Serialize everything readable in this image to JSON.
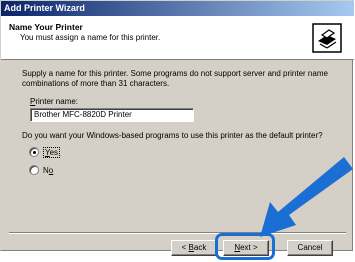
{
  "window": {
    "title": "Add Printer Wizard"
  },
  "header": {
    "title": "Name Your Printer",
    "subtitle": "You must assign a name for this printer."
  },
  "body": {
    "description": "Supply a name for this printer. Some programs do not support server and printer name combinations of more than 31 characters.",
    "printer_name_label": "Printer name:",
    "printer_name_value": "Brother MFC-8820D Printer",
    "default_question": "Do you want your Windows-based programs to use this printer as the default printer?",
    "options": [
      {
        "label": "Yes",
        "selected": true
      },
      {
        "label": "No",
        "selected": false
      }
    ]
  },
  "buttons": {
    "back": "< Back",
    "next": "Next >",
    "cancel": "Cancel"
  },
  "colors": {
    "highlight": "#1b6fd4",
    "arrow": "#1b6fd4",
    "titlebar": "#0a246a"
  },
  "icons": {
    "header": "printer-icon"
  }
}
